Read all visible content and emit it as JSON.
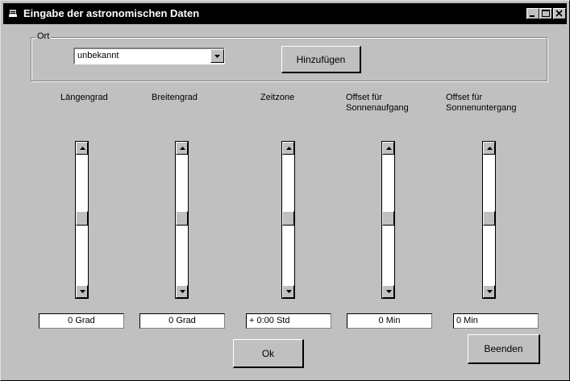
{
  "window": {
    "title": "Eingabe der astronomischen Daten",
    "titlebar_color": "#000000",
    "background": "#c0c0c0"
  },
  "ort": {
    "group_label": "Ort",
    "combo_value": "unbekannt",
    "add_button": "Hinzufügen"
  },
  "columns": [
    {
      "label": "Längengrad",
      "value": "0 Grad"
    },
    {
      "label": "Breitengrad",
      "value": "0 Grad"
    },
    {
      "label": "Zeitzone",
      "value": "+ 0:00 Std"
    },
    {
      "label": "Offset für\nSonnenaufgang",
      "value": "0 Min"
    },
    {
      "label": "Offset für\nSonnenuntergang",
      "value": "0 Min"
    }
  ],
  "buttons": {
    "ok": "Ok",
    "close": "Beenden"
  }
}
